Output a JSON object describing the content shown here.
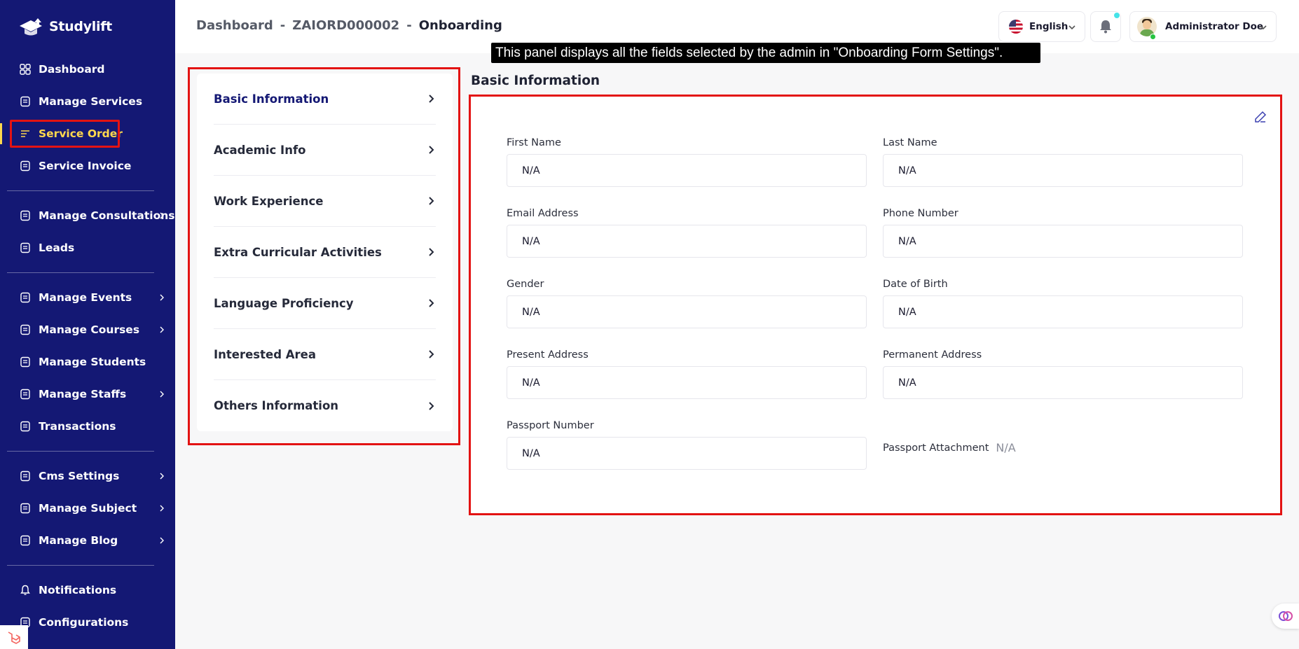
{
  "brand": {
    "name": "Studylift"
  },
  "sidebar": {
    "items": [
      {
        "label": "Dashboard",
        "icon": "dashboard-icon"
      },
      {
        "label": "Manage Services",
        "icon": "services-icon"
      },
      {
        "label": "Service Order",
        "icon": "order-icon",
        "active": true
      },
      {
        "label": "Service Invoice",
        "icon": "invoice-icon"
      },
      {
        "label": "Manage Consultations",
        "icon": "consultation-icon",
        "submenu": true
      },
      {
        "label": "Leads",
        "icon": "leads-icon"
      },
      {
        "label": "Manage Events",
        "icon": "calendar-icon",
        "submenu": true
      },
      {
        "label": "Manage Courses",
        "icon": "courses-icon",
        "submenu": true
      },
      {
        "label": "Manage Students",
        "icon": "students-icon"
      },
      {
        "label": "Manage Staffs",
        "icon": "staffs-icon",
        "submenu": true
      },
      {
        "label": "Transactions",
        "icon": "transactions-icon"
      },
      {
        "label": "Cms Settings",
        "icon": "settings-icon",
        "submenu": true
      },
      {
        "label": "Manage Subject",
        "icon": "book-icon",
        "submenu": true
      },
      {
        "label": "Manage Blog",
        "icon": "blog-icon",
        "submenu": true
      },
      {
        "label": "Notifications",
        "icon": "bell-icon"
      },
      {
        "label": "Configurations",
        "icon": "config-icon"
      }
    ]
  },
  "header": {
    "breadcrumb": [
      "Dashboard",
      "ZAIORD000002",
      "Onboarding"
    ],
    "separator": "-",
    "language": "English",
    "user_name": "Administrator Doe"
  },
  "tooltip": "This panel displays all the fields selected by the admin in \"Onboarding Form Settings\".",
  "tabs": [
    {
      "label": "Basic Information",
      "active": true
    },
    {
      "label": "Academic Info"
    },
    {
      "label": "Work Experience"
    },
    {
      "label": "Extra Curricular Activities"
    },
    {
      "label": "Language Proficiency"
    },
    {
      "label": "Interested Area"
    },
    {
      "label": "Others Information"
    }
  ],
  "form": {
    "title": "Basic Information",
    "fields": [
      {
        "label": "First Name",
        "value": "N/A"
      },
      {
        "label": "Last Name",
        "value": "N/A"
      },
      {
        "label": "Email Address",
        "value": "N/A"
      },
      {
        "label": "Phone Number",
        "value": "N/A"
      },
      {
        "label": "Gender",
        "value": "N/A"
      },
      {
        "label": "Date of Birth",
        "value": "N/A"
      },
      {
        "label": "Present Address",
        "value": "N/A"
      },
      {
        "label": "Permanent Address",
        "value": "N/A"
      },
      {
        "label": "Passport Number",
        "value": "N/A"
      }
    ],
    "attachment": {
      "label": "Passport Attachment",
      "value": "N/A"
    }
  },
  "colors": {
    "sidebar_bg": "#141874",
    "active_nav": "#ffd84d",
    "highlight_border": "#e31313",
    "notification_dot": "#46e3e8"
  }
}
